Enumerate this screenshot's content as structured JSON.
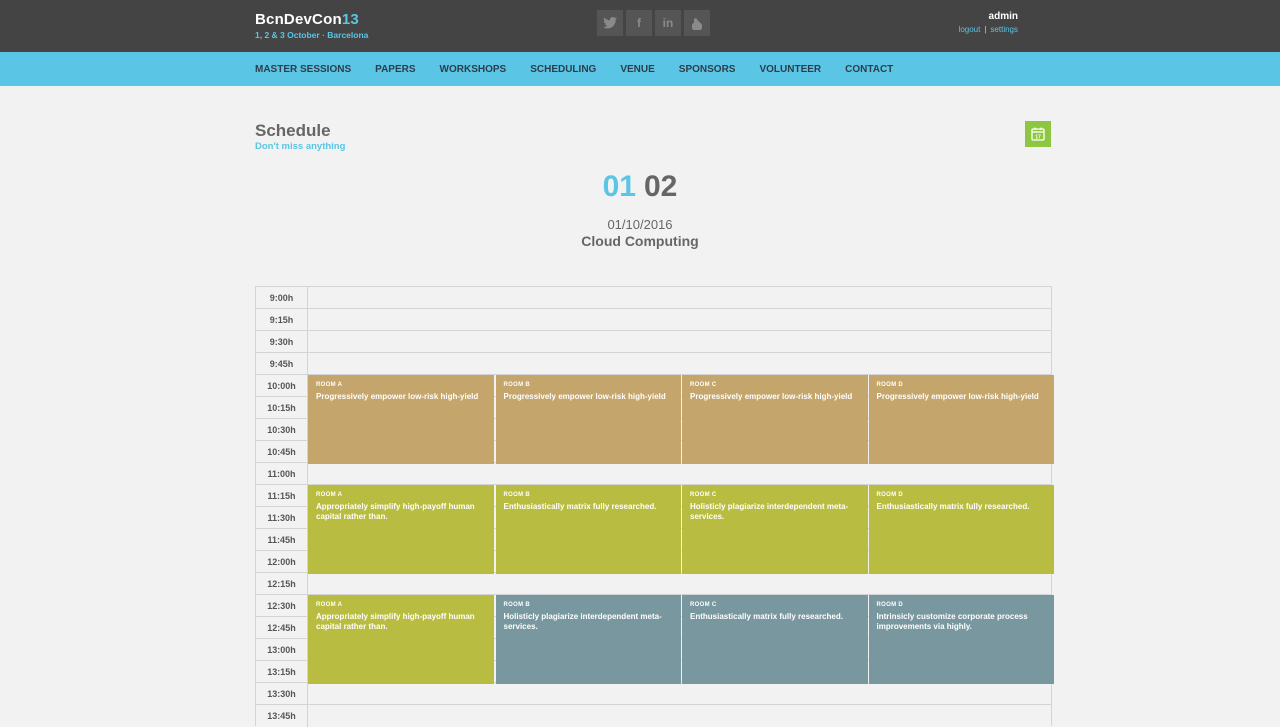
{
  "header": {
    "brand_main": "BcnDevCon",
    "brand_accent": "13",
    "tagline": "1, 2 & 3 October · Barcelona",
    "social": [
      {
        "icon": "twitter-icon",
        "glyph": "t"
      },
      {
        "icon": "facebook-icon",
        "glyph": "f"
      },
      {
        "icon": "linkedin-icon",
        "glyph": "in"
      },
      {
        "icon": "github-icon",
        "glyph": "g"
      }
    ],
    "user": {
      "name": "admin",
      "logout": "logout",
      "separator": "|",
      "settings": "settings"
    }
  },
  "nav": [
    "MASTER SESSIONS",
    "PAPERS",
    "WORKSHOPS",
    "SCHEDULING",
    "VENUE",
    "SPONSORS",
    "VOLUNTEER",
    "CONTACT"
  ],
  "page": {
    "title": "Schedule",
    "subtitle": "Don't miss anything",
    "calendar_icon": "calendar-icon",
    "calendar_day": "17",
    "day_active": "01",
    "day_other": "02",
    "date": "01/10/2016",
    "track": "Cloud Computing"
  },
  "colors": {
    "tan": "#c4a56b",
    "lime": "#b8bc40",
    "slate": "#78979e",
    "accent": "#5bc5e5",
    "calendar": "#8dc63f"
  },
  "schedule": {
    "times": [
      "9:00h",
      "9:15h",
      "9:30h",
      "9:45h",
      "10:00h",
      "10:15h",
      "10:30h",
      "10:45h",
      "11:00h",
      "11:15h",
      "11:30h",
      "11:45h",
      "12:00h",
      "12:15h",
      "12:30h",
      "12:45h",
      "13:00h",
      "13:15h",
      "13:30h",
      "13:45h"
    ],
    "blocks": [
      {
        "start": "10:00h",
        "color": "tan",
        "sessions": [
          {
            "room": "ROOM A",
            "title": "Progressively empower low-risk high-yield",
            "color": "tan"
          },
          {
            "room": "ROOM B",
            "title": "Progressively empower low-risk high-yield",
            "color": "tan"
          },
          {
            "room": "ROOM C",
            "title": "Progressively empower low-risk high-yield",
            "color": "tan"
          },
          {
            "room": "ROOM D",
            "title": "Progressively empower low-risk high-yield",
            "color": "tan"
          }
        ]
      },
      {
        "start": "11:15h",
        "color": "lime",
        "sessions": [
          {
            "room": "ROOM A",
            "title": "Appropriately simplify high-payoff human capital rather than.",
            "color": "lime"
          },
          {
            "room": "ROOM B",
            "title": "Enthusiastically matrix fully researched.",
            "color": "lime"
          },
          {
            "room": "ROOM C",
            "title": "Holisticly plagiarize interdependent meta-services.",
            "color": "lime"
          },
          {
            "room": "ROOM D",
            "title": "Enthusiastically matrix fully researched.",
            "color": "lime"
          }
        ]
      },
      {
        "start": "12:30h",
        "color": "slate",
        "sessions": [
          {
            "room": "ROOM A",
            "title": "Appropriately simplify high-payoff human capital rather than.",
            "color": "lime"
          },
          {
            "room": "ROOM B",
            "title": "Holisticly plagiarize interdependent meta-services.",
            "color": "slate"
          },
          {
            "room": "ROOM C",
            "title": "Enthusiastically matrix fully researched.",
            "color": "slate"
          },
          {
            "room": "ROOM D",
            "title": "Intrinsicly customize corporate process improvements via highly.",
            "color": "slate"
          }
        ]
      }
    ]
  }
}
